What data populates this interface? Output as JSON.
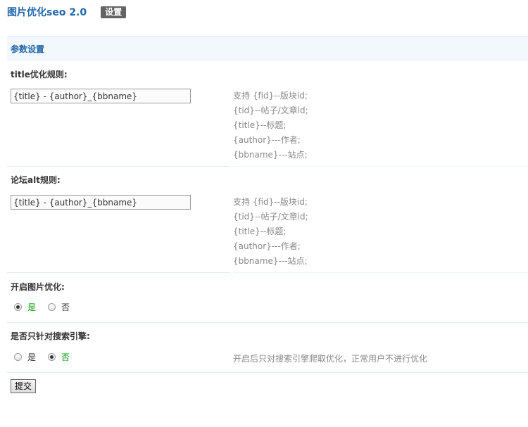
{
  "header": {
    "title": "图片优化seo 2.0",
    "badge": "设置"
  },
  "section": {
    "title": "参数设置"
  },
  "settings": {
    "title_rule": {
      "label": "title优化规则:",
      "value": "{title} - {author}_{bbname}",
      "hints": [
        "支持 {fid}--版块id;",
        "{tid}--帖子/文章id;",
        "{title}--标题;",
        "{author}---作者;",
        "{bbname}---站点;"
      ]
    },
    "alt_rule": {
      "label": "论坛alt规则:",
      "value": "{title} - {author}_{bbname}",
      "hints": [
        "支持 {fid}--版块id;",
        "{tid}--帖子/文章id;",
        "{title}--标题;",
        "{author}---作者;",
        "{bbname}---站点;"
      ]
    },
    "enable_optimize": {
      "label": "开启图片优化:",
      "options": [
        "是",
        "否"
      ],
      "selected": "是"
    },
    "search_only": {
      "label": "是否只针对搜索引擎:",
      "options": [
        "是",
        "否"
      ],
      "selected": "否",
      "hint": "开启后只对搜索引擎爬取优化，正常用户不进行优化"
    }
  },
  "submit_label": "提交",
  "colors": {
    "title": "#2366a8",
    "section_bg": "#f2f8fd",
    "active_option": "#009900",
    "hint": "#888888",
    "badge_bg": "#636363"
  }
}
